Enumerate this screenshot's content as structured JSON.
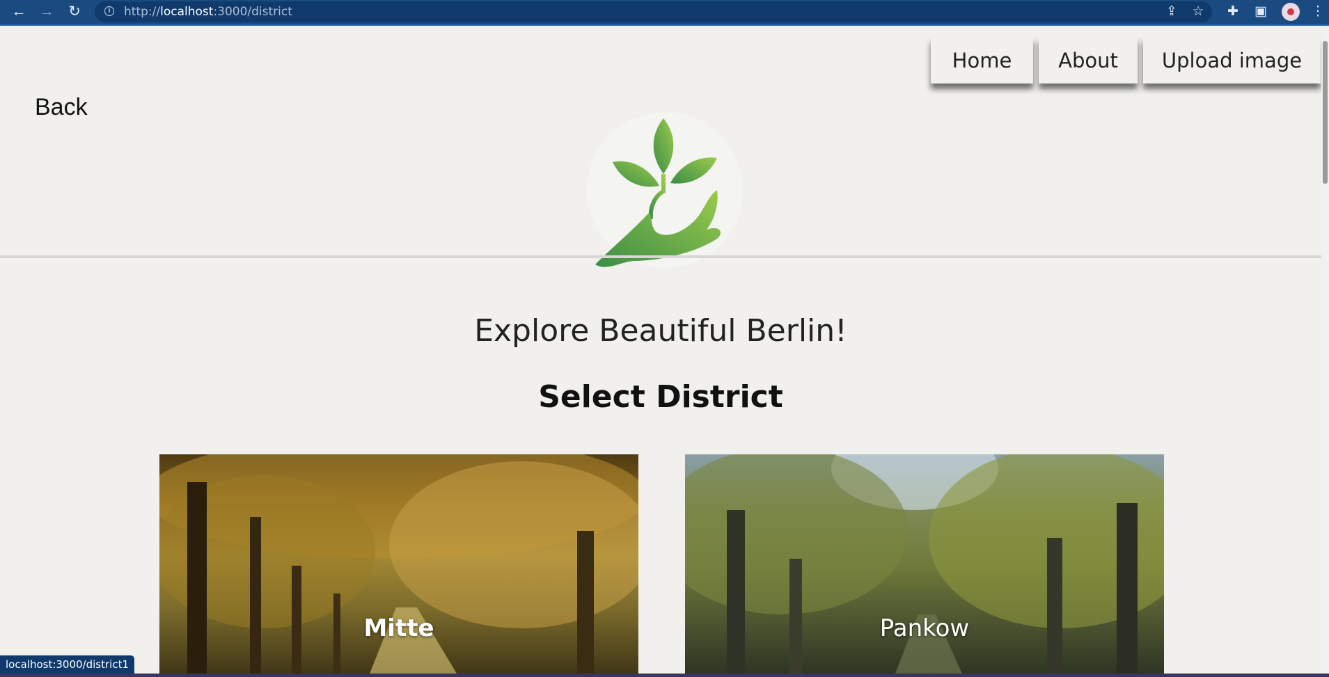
{
  "browser": {
    "url_prefix": "http://",
    "url_host": "localhost",
    "url_rest": ":3000/district",
    "status_link": "localhost:3000/district1"
  },
  "nav": {
    "home": "Home",
    "about": "About",
    "upload": "Upload image"
  },
  "back_label": "Back",
  "headline": "Explore Beautiful Berlin!",
  "subheadline": "Select District",
  "districts": [
    {
      "name": "Mitte"
    },
    {
      "name": "Pankow"
    }
  ],
  "colors": {
    "chrome": "#1a4a80",
    "page_bg": "#f1f0ed",
    "logo_green_dark": "#3c8d47",
    "logo_green_light": "#9ccb4c"
  }
}
